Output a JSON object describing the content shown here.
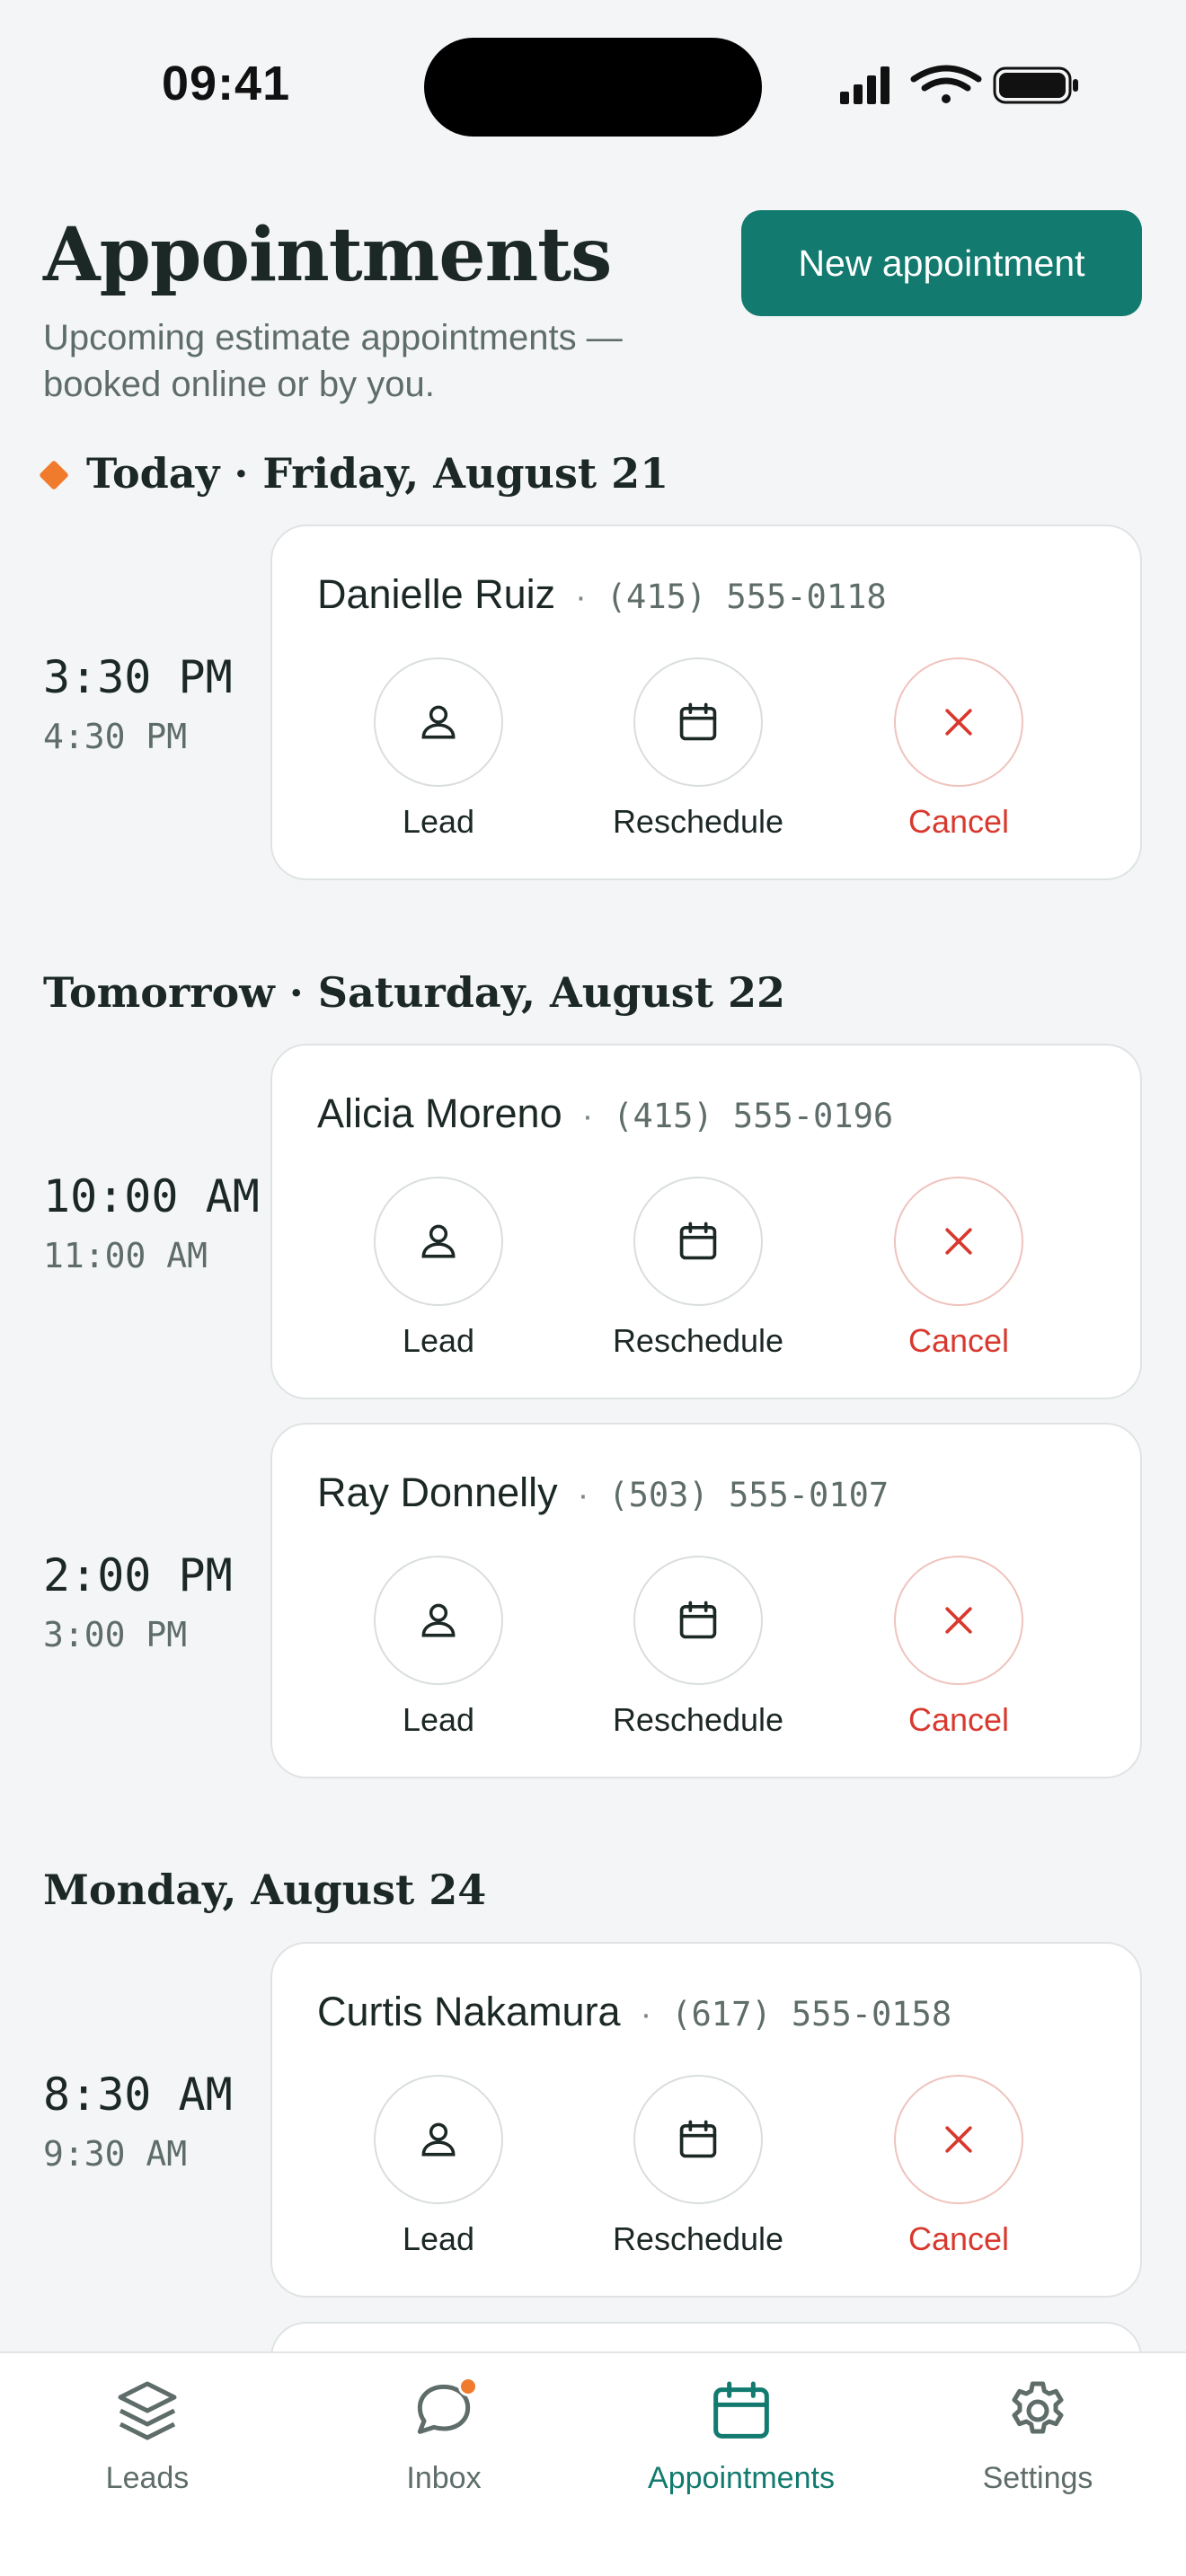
{
  "status_bar": {
    "time": "09:41"
  },
  "header": {
    "title": "Appointments",
    "subtitle": "Upcoming estimate appointments — booked online or by you.",
    "new_button": "New appointment"
  },
  "days": [
    {
      "heading": "Today · Friday, August 21",
      "appointments": [
        {
          "start": "3:30 PM",
          "end": "4:30 PM",
          "name": "Danielle Ruiz",
          "phone": "(415) 555-0118"
        }
      ]
    },
    {
      "heading": "Tomorrow · Saturday, August 22",
      "appointments": [
        {
          "start": "10:00 AM",
          "end": "11:00 AM",
          "name": "Alicia Moreno",
          "phone": "(415) 555-0196"
        },
        {
          "start": "2:00 PM",
          "end": "3:00 PM",
          "name": "Ray Donnelly",
          "phone": "(503) 555-0107"
        }
      ]
    },
    {
      "heading": "Monday, August 24",
      "appointments": [
        {
          "start": "8:30 AM",
          "end": "9:30 AM",
          "name": "Curtis Nakamura",
          "phone": "(617) 555-0158"
        }
      ]
    }
  ],
  "actions": {
    "lead": "Lead",
    "reschedule": "Reschedule",
    "cancel": "Cancel",
    "separator": "·"
  },
  "tabs": [
    {
      "label": "Leads",
      "icon": "layers-icon"
    },
    {
      "label": "Inbox",
      "icon": "chat-bubble-icon"
    },
    {
      "label": "Appointments",
      "icon": "calendar-icon",
      "active": true
    },
    {
      "label": "Settings",
      "icon": "gear-icon"
    }
  ],
  "colors": {
    "accent": "#127a6e",
    "badge": "#f07b2d",
    "cancel": "#d8392e"
  }
}
